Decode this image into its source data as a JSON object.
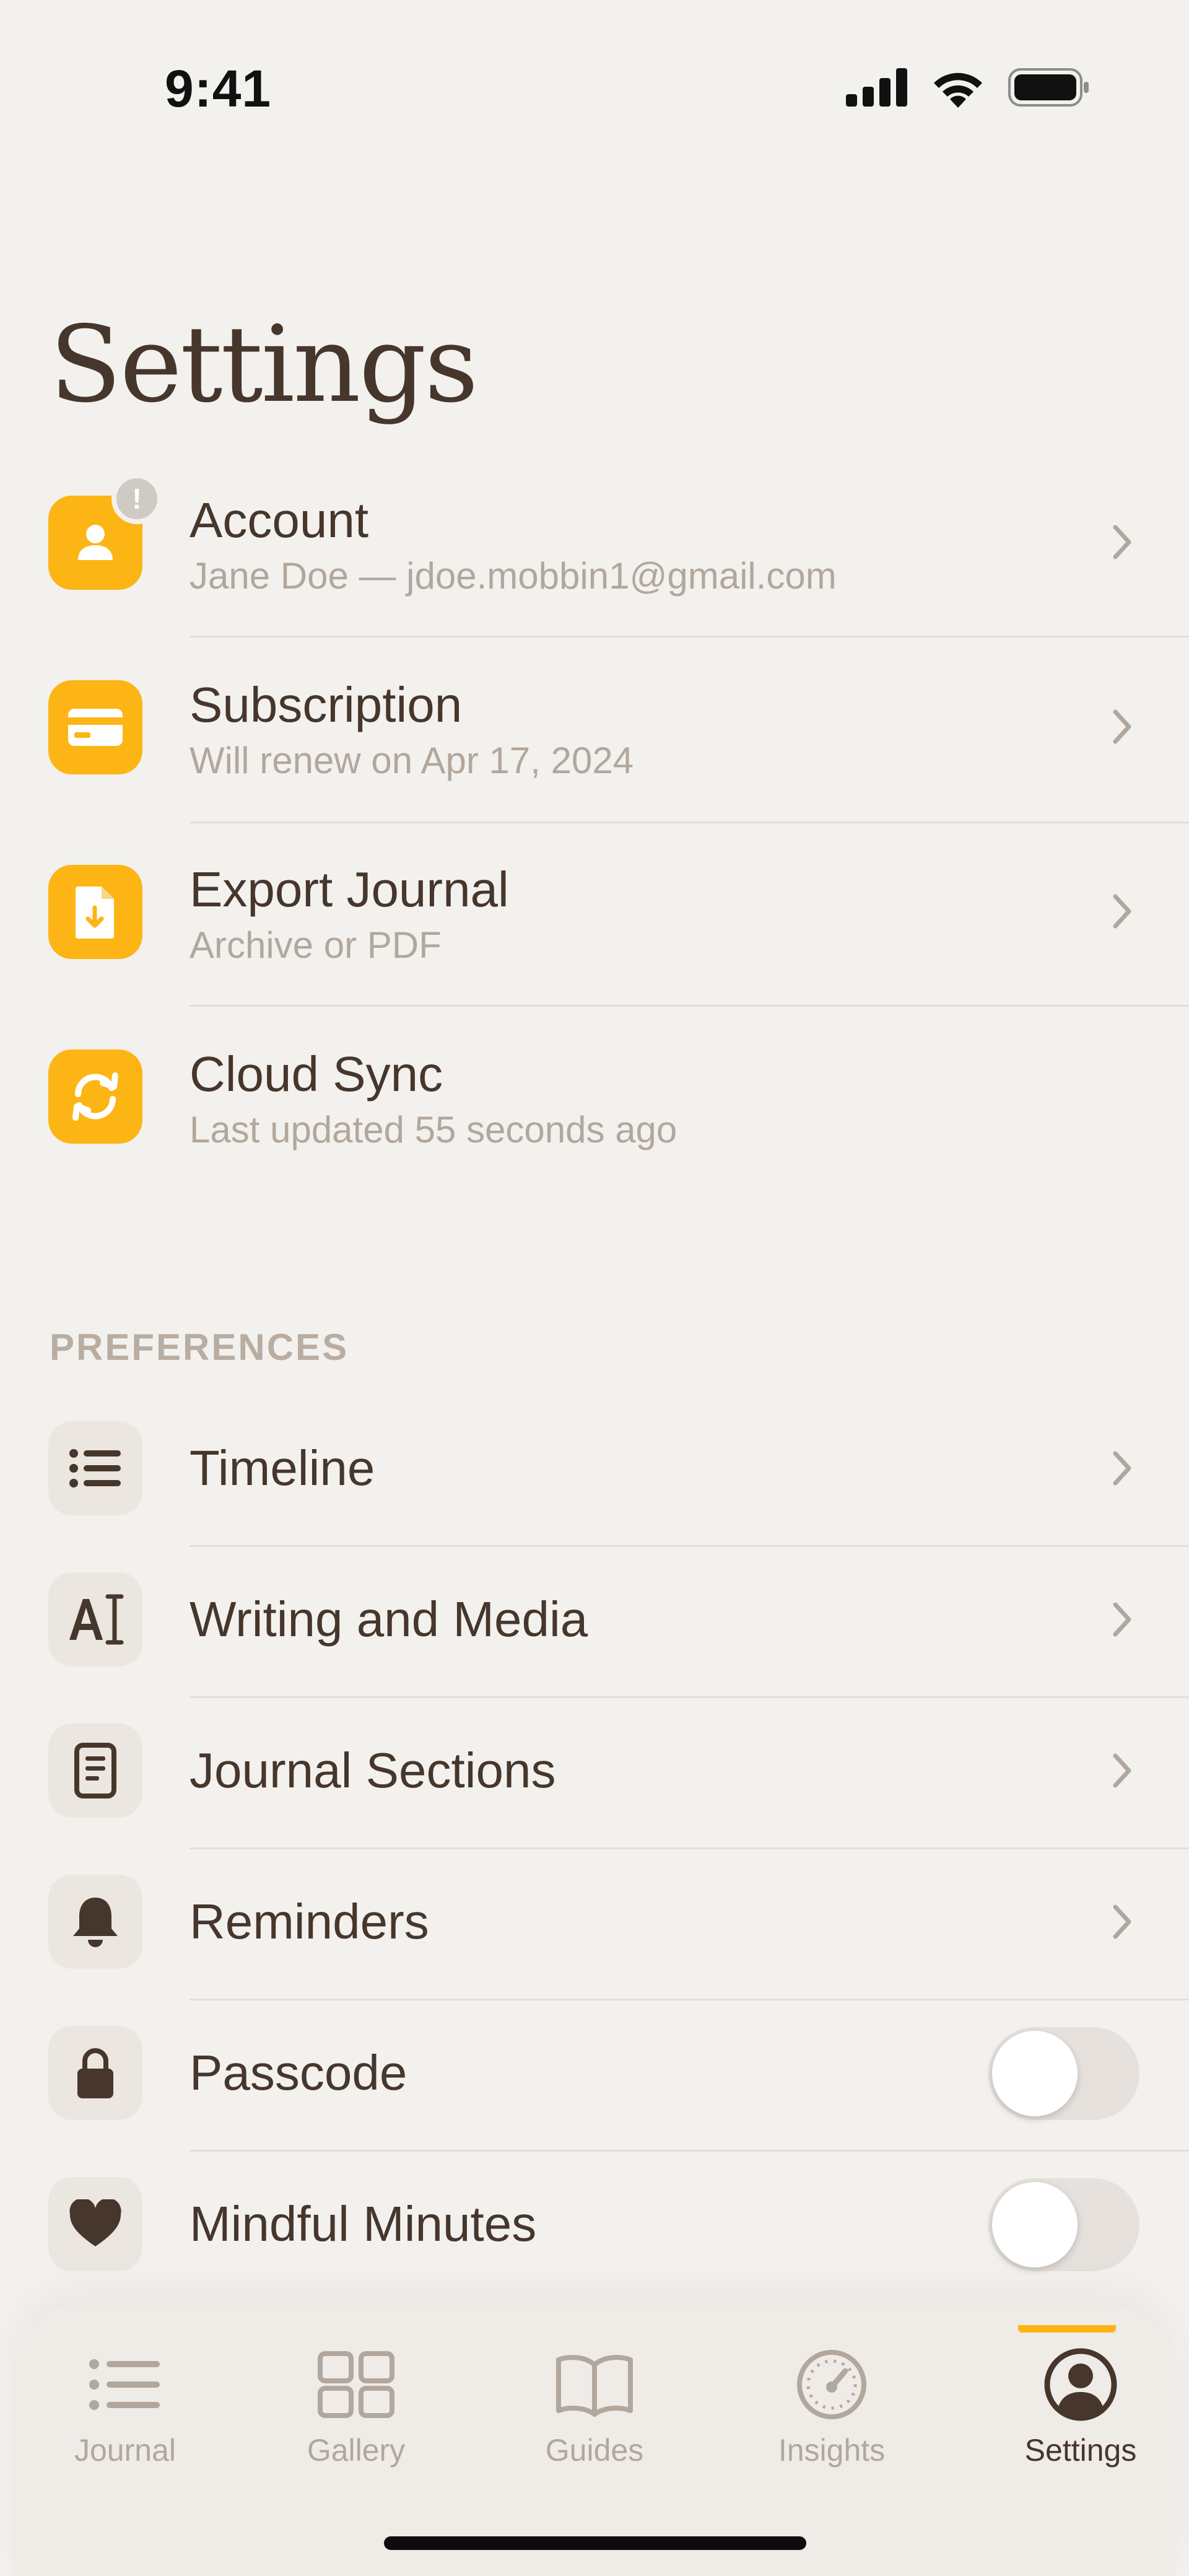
{
  "status": {
    "time": "9:41"
  },
  "title": "Settings",
  "main_rows": [
    {
      "name": "account",
      "title": "Account",
      "subtitle": "Jane Doe — jdoe.mobbin1@gmail.com",
      "icon": "person-icon",
      "badge": "!"
    },
    {
      "name": "subscription",
      "title": "Subscription",
      "subtitle": "Will renew on Apr 17, 2024",
      "icon": "credit-card-icon"
    },
    {
      "name": "export-journal",
      "title": "Export Journal",
      "subtitle": "Archive or PDF",
      "icon": "document-download-icon"
    },
    {
      "name": "cloud-sync",
      "title": "Cloud Sync",
      "subtitle": "Last updated 55 seconds ago",
      "icon": "sync-icon"
    }
  ],
  "preferences": {
    "header": "PREFERENCES",
    "items": [
      {
        "name": "timeline",
        "label": "Timeline",
        "icon": "list-icon"
      },
      {
        "name": "writing-media",
        "label": "Writing and Media",
        "icon": "text-cursor-icon"
      },
      {
        "name": "journal-sections",
        "label": "Journal Sections",
        "icon": "notebook-icon"
      },
      {
        "name": "reminders",
        "label": "Reminders",
        "icon": "bell-icon"
      },
      {
        "name": "passcode",
        "label": "Passcode",
        "icon": "lock-icon",
        "toggle": false
      },
      {
        "name": "mindful-minutes",
        "label": "Mindful Minutes",
        "icon": "heart-icon",
        "toggle": false
      }
    ]
  },
  "tabs": [
    {
      "name": "journal",
      "label": "Journal",
      "icon": "list-icon",
      "active": false
    },
    {
      "name": "gallery",
      "label": "Gallery",
      "icon": "grid-icon",
      "active": false
    },
    {
      "name": "guides",
      "label": "Guides",
      "icon": "book-icon",
      "active": false
    },
    {
      "name": "insights",
      "label": "Insights",
      "icon": "gauge-icon",
      "active": false
    },
    {
      "name": "settings",
      "label": "Settings",
      "icon": "profile-icon",
      "active": true
    }
  ],
  "colors": {
    "accent": "#fcb514",
    "text": "#46362b",
    "muted": "#b2a79c",
    "background": "#f3f1ee"
  }
}
